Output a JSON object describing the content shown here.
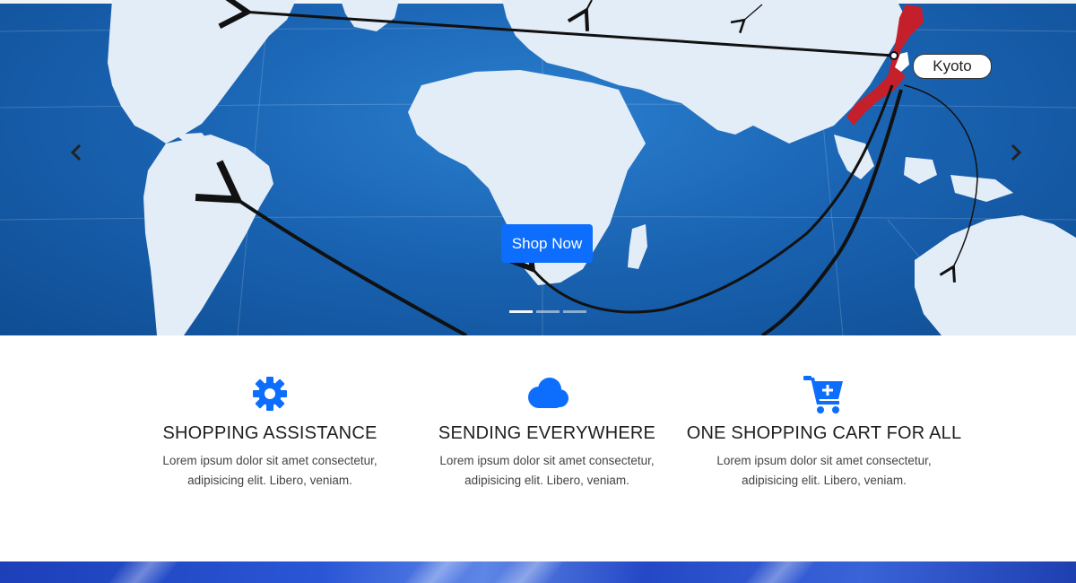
{
  "hero": {
    "shop_button_label": "Shop Now",
    "location_tag": "Kyoto",
    "prev_icon": "chevron-left-icon",
    "next_icon": "chevron-right-icon",
    "slide_count": 3,
    "active_slide": 1
  },
  "features": [
    {
      "icon": "gear-icon",
      "title": "SHOPPING ASSISTANCE",
      "text_line1": "Lorem ipsum dolor sit amet consectetur,",
      "text_line2": "adipisicing elit. Libero, veniam."
    },
    {
      "icon": "cloud-icon",
      "title": "SENDING EVERYWHERE",
      "text_line1": "Lorem ipsum dolor sit amet consectetur,",
      "text_line2": "adipisicing elit. Libero, veniam."
    },
    {
      "icon": "cart-plus-icon",
      "title": "ONE SHOPPING CART FOR ALL",
      "text_line1": "Lorem ipsum dolor sit amet consectetur,",
      "text_line2": "adipisicing elit. Libero, veniam."
    }
  ],
  "colors": {
    "accent": "#0d6efd",
    "hero_ocean": "#1a64b3",
    "land": "#e3edf7",
    "japan": "#c4202b"
  }
}
